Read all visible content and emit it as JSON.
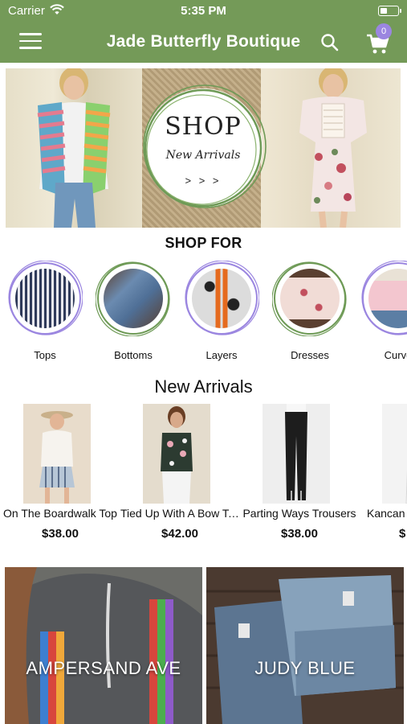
{
  "status_bar": {
    "carrier": "Carrier",
    "time": "5:35 PM"
  },
  "nav": {
    "title": "Jade Butterfly Boutique",
    "cart_count": "0"
  },
  "hero": {
    "shop": "SHOP",
    "subtitle": "New Arrivals",
    "arrows": "> > >"
  },
  "shop_for": {
    "title": "SHOP FOR",
    "categories": [
      {
        "label": "Tops"
      },
      {
        "label": "Bottoms"
      },
      {
        "label": "Layers"
      },
      {
        "label": "Dresses"
      },
      {
        "label": "Curve"
      }
    ]
  },
  "new_arrivals": {
    "title": "New Arrivals",
    "products": [
      {
        "name": "On The Boardwalk Top",
        "price": "$38.00"
      },
      {
        "name": "Tied Up With A Bow Top",
        "price": "$42.00"
      },
      {
        "name": "Parting Ways Trousers",
        "price": "$38.00"
      },
      {
        "name": "Kancan",
        "price": "$"
      }
    ]
  },
  "brands": [
    {
      "label": "AMPERSAND AVE"
    },
    {
      "label": "JUDY BLUE"
    }
  ],
  "colors": {
    "accent": "#749a58",
    "badge": "#9b86e0"
  }
}
